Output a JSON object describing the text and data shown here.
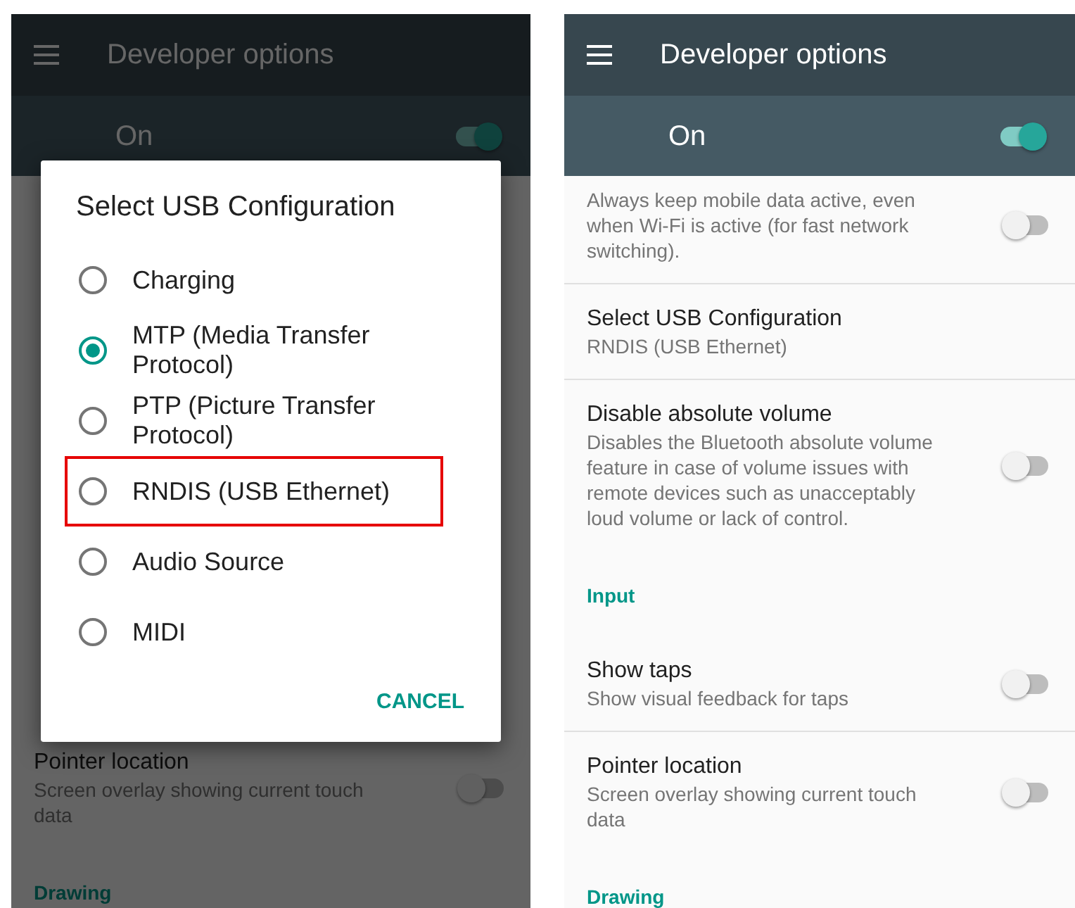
{
  "panels": [
    {
      "app_bar": {
        "title": "Developer options"
      },
      "master_switch": {
        "label": "On",
        "on": true
      },
      "rows": [
        {
          "kind": "setting",
          "title": "Pointer location",
          "summary": "Screen overlay showing current touch data",
          "switch": {
            "on": false
          }
        },
        {
          "kind": "header",
          "title": "Drawing"
        }
      ],
      "dialog": {
        "title": "Select USB Configuration",
        "options": [
          {
            "label": "Charging",
            "selected": false,
            "highlighted": false
          },
          {
            "label": "MTP (Media Transfer Protocol)",
            "selected": true,
            "highlighted": false
          },
          {
            "label": "PTP (Picture Transfer Protocol)",
            "selected": false,
            "highlighted": false
          },
          {
            "label": "RNDIS (USB Ethernet)",
            "selected": false,
            "highlighted": true
          },
          {
            "label": "Audio Source",
            "selected": false,
            "highlighted": false
          },
          {
            "label": "MIDI",
            "selected": false,
            "highlighted": false
          }
        ],
        "button": "CANCEL"
      }
    },
    {
      "app_bar": {
        "title": "Developer options"
      },
      "master_switch": {
        "label": "On",
        "on": true
      },
      "rows": [
        {
          "kind": "setting",
          "summary": "Always keep mobile data active, even when Wi-Fi is active (for fast network switching).",
          "switch": {
            "on": false
          }
        },
        {
          "kind": "setting",
          "title": "Select USB Configuration",
          "summary": "RNDIS (USB Ethernet)"
        },
        {
          "kind": "setting",
          "title": "Disable absolute volume",
          "summary": "Disables the Bluetooth absolute volume feature in case of volume issues with remote devices such as unacceptably loud volume or lack of control.",
          "switch": {
            "on": false
          }
        },
        {
          "kind": "header",
          "title": "Input"
        },
        {
          "kind": "setting",
          "title": "Show taps",
          "summary": "Show visual feedback for taps",
          "switch": {
            "on": false
          }
        },
        {
          "kind": "setting",
          "title": "Pointer location",
          "summary": "Screen overlay showing current touch data",
          "switch": {
            "on": false
          }
        },
        {
          "kind": "header",
          "title": "Drawing"
        }
      ]
    }
  ]
}
